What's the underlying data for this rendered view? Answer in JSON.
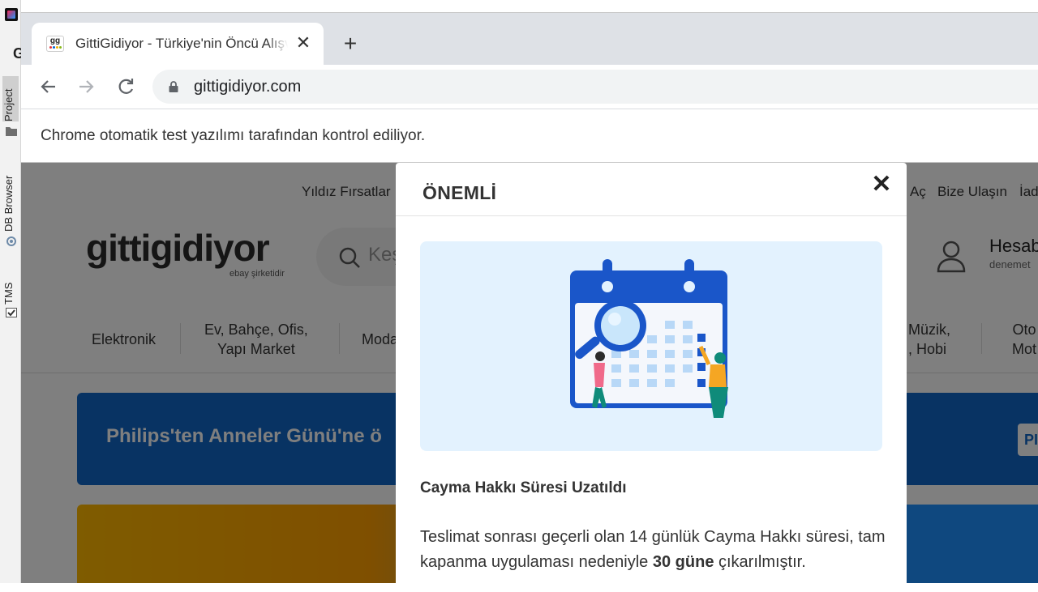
{
  "ide": {
    "tabs": [
      "Project",
      "DB Browser",
      "TMS"
    ],
    "letter": "G"
  },
  "browser": {
    "tab_title": "GittiGidiyor - Türkiye'nin Öncü Alışveriş Sitesi",
    "favicon_text": "gg",
    "new_tab": "+",
    "close_tab": "✕",
    "url": "gittigidiyor.com",
    "infobar": "Chrome otomatik test yazılımı tarafından kontrol ediliyor."
  },
  "site": {
    "topnav": {
      "left": "Yıldız Fırsatlar",
      "right": [
        "Aç",
        "Bize Ulaşın",
        "İad"
      ]
    },
    "logo": "gittigidiyor",
    "logo_sub": "ebay şirketidir",
    "search_placeholder": "Keş",
    "account": {
      "title": "Hesab",
      "sub": "denemet"
    },
    "categories": [
      "Elektronik",
      "Ev, Bahçe, Ofis,\nYapı Market",
      "Moda",
      "Müzik,\n, Hobi",
      "Oto\nMot"
    ],
    "banner_text": "Philips'ten Anneler Günü'ne ö",
    "banner_badge": "PI"
  },
  "modal": {
    "title": "ÖNEMLİ",
    "close": "✕",
    "subtitle": "Cayma Hakkı Süresi Uzatıldı",
    "body_part1": "Teslimat sonrası geçerli olan 14 günlük Cayma Hakkı süresi, tam kapanma uygulaması nedeniyle ",
    "body_bold": "30 güne",
    "body_part2": " çıkarılmıştır."
  },
  "colors": {
    "tabstrip": "#dee1e6",
    "omnibox": "#f1f3f4",
    "illustration_bg": "#e3f2fe",
    "calendar_blue": "#1a56c9",
    "banner_blue": "#1167c6"
  }
}
